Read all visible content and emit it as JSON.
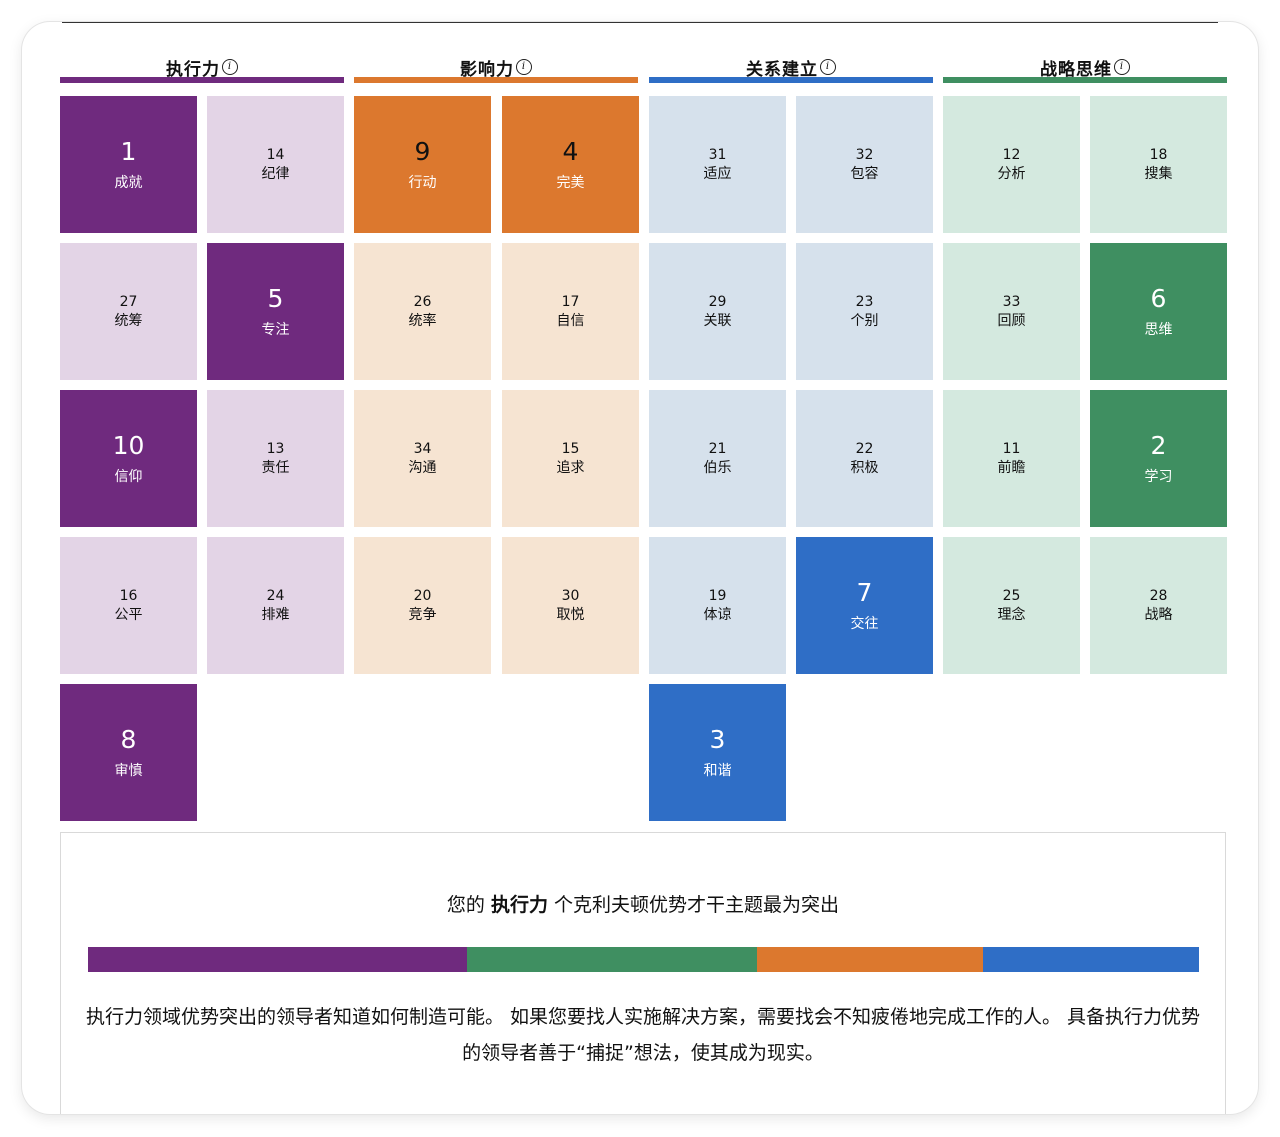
{
  "categories": [
    {
      "key": "exec",
      "label": "执行力",
      "info_icon": "info-circle-icon",
      "color": "#6f2a7e",
      "light": "#e3d4e6"
    },
    {
      "key": "infl",
      "label": "影响力",
      "info_icon": "info-circle-icon",
      "color": "#dc782e",
      "light": "#f6e4d2"
    },
    {
      "key": "rel",
      "label": "关系建立",
      "info_icon": "info-circle-icon",
      "color": "#2f6ec6",
      "light": "#d6e1ec"
    },
    {
      "key": "strat",
      "label": "战略思维",
      "info_icon": "info-circle-icon",
      "color": "#3f8f61",
      "light": "#d4e9df"
    }
  ],
  "tiles": [
    {
      "rank": "1",
      "name": "成就",
      "top": true,
      "cat": "exec"
    },
    {
      "rank": "14",
      "name": "纪律",
      "top": false,
      "cat": "exec"
    },
    {
      "rank": "27",
      "name": "统筹",
      "top": false,
      "cat": "exec"
    },
    {
      "rank": "5",
      "name": "专注",
      "top": true,
      "cat": "exec"
    },
    {
      "rank": "10",
      "name": "信仰",
      "top": true,
      "cat": "exec"
    },
    {
      "rank": "13",
      "name": "责任",
      "top": false,
      "cat": "exec"
    },
    {
      "rank": "16",
      "name": "公平",
      "top": false,
      "cat": "exec"
    },
    {
      "rank": "24",
      "name": "排难",
      "top": false,
      "cat": "exec"
    },
    {
      "rank": "8",
      "name": "审慎",
      "top": true,
      "cat": "exec"
    },
    {
      "rank": "9",
      "name": "行动",
      "top": true,
      "cat": "infl"
    },
    {
      "rank": "4",
      "name": "完美",
      "top": true,
      "cat": "infl"
    },
    {
      "rank": "26",
      "name": "统率",
      "top": false,
      "cat": "infl"
    },
    {
      "rank": "17",
      "name": "自信",
      "top": false,
      "cat": "infl"
    },
    {
      "rank": "34",
      "name": "沟通",
      "top": false,
      "cat": "infl"
    },
    {
      "rank": "15",
      "name": "追求",
      "top": false,
      "cat": "infl"
    },
    {
      "rank": "20",
      "name": "竞争",
      "top": false,
      "cat": "infl"
    },
    {
      "rank": "30",
      "name": "取悦",
      "top": false,
      "cat": "infl"
    },
    {
      "rank": "31",
      "name": "适应",
      "top": false,
      "cat": "rel"
    },
    {
      "rank": "32",
      "name": "包容",
      "top": false,
      "cat": "rel"
    },
    {
      "rank": "29",
      "name": "关联",
      "top": false,
      "cat": "rel"
    },
    {
      "rank": "23",
      "name": "个别",
      "top": false,
      "cat": "rel"
    },
    {
      "rank": "21",
      "name": "伯乐",
      "top": false,
      "cat": "rel"
    },
    {
      "rank": "22",
      "name": "积极",
      "top": false,
      "cat": "rel"
    },
    {
      "rank": "19",
      "name": "体谅",
      "top": false,
      "cat": "rel"
    },
    {
      "rank": "7",
      "name": "交往",
      "top": true,
      "cat": "rel"
    },
    {
      "rank": "3",
      "name": "和谐",
      "top": true,
      "cat": "rel"
    },
    {
      "rank": "12",
      "name": "分析",
      "top": false,
      "cat": "strat"
    },
    {
      "rank": "18",
      "name": "搜集",
      "top": false,
      "cat": "strat"
    },
    {
      "rank": "33",
      "name": "回顾",
      "top": false,
      "cat": "strat"
    },
    {
      "rank": "6",
      "name": "思维",
      "top": true,
      "cat": "strat"
    },
    {
      "rank": "11",
      "name": "前瞻",
      "top": false,
      "cat": "strat"
    },
    {
      "rank": "2",
      "name": "学习",
      "top": true,
      "cat": "strat"
    },
    {
      "rank": "25",
      "name": "理念",
      "top": false,
      "cat": "strat"
    },
    {
      "rank": "28",
      "name": "战略",
      "top": false,
      "cat": "strat"
    }
  ],
  "summary": {
    "title_prefix": "您的",
    "title_highlight": "执行力",
    "title_suffix": "个克利夫顿优势才干主题最为突出",
    "distribution": [
      {
        "cat": "exec",
        "color": "#6f2a7e",
        "fraction": 0.3415
      },
      {
        "cat": "strat",
        "color": "#3f8f61",
        "fraction": 0.261
      },
      {
        "cat": "infl",
        "color": "#dc782e",
        "fraction": 0.2035
      },
      {
        "cat": "rel",
        "color": "#2f6ec6",
        "fraction": 0.194
      }
    ],
    "description": "执行力领域优势突出的领导者知道如何制造可能。 如果您要找人实施解决方案，需要找会不知疲倦地完成工作的人。 具备执行力优势的领导者善于“捕捉”想法，使其成为现实。"
  }
}
